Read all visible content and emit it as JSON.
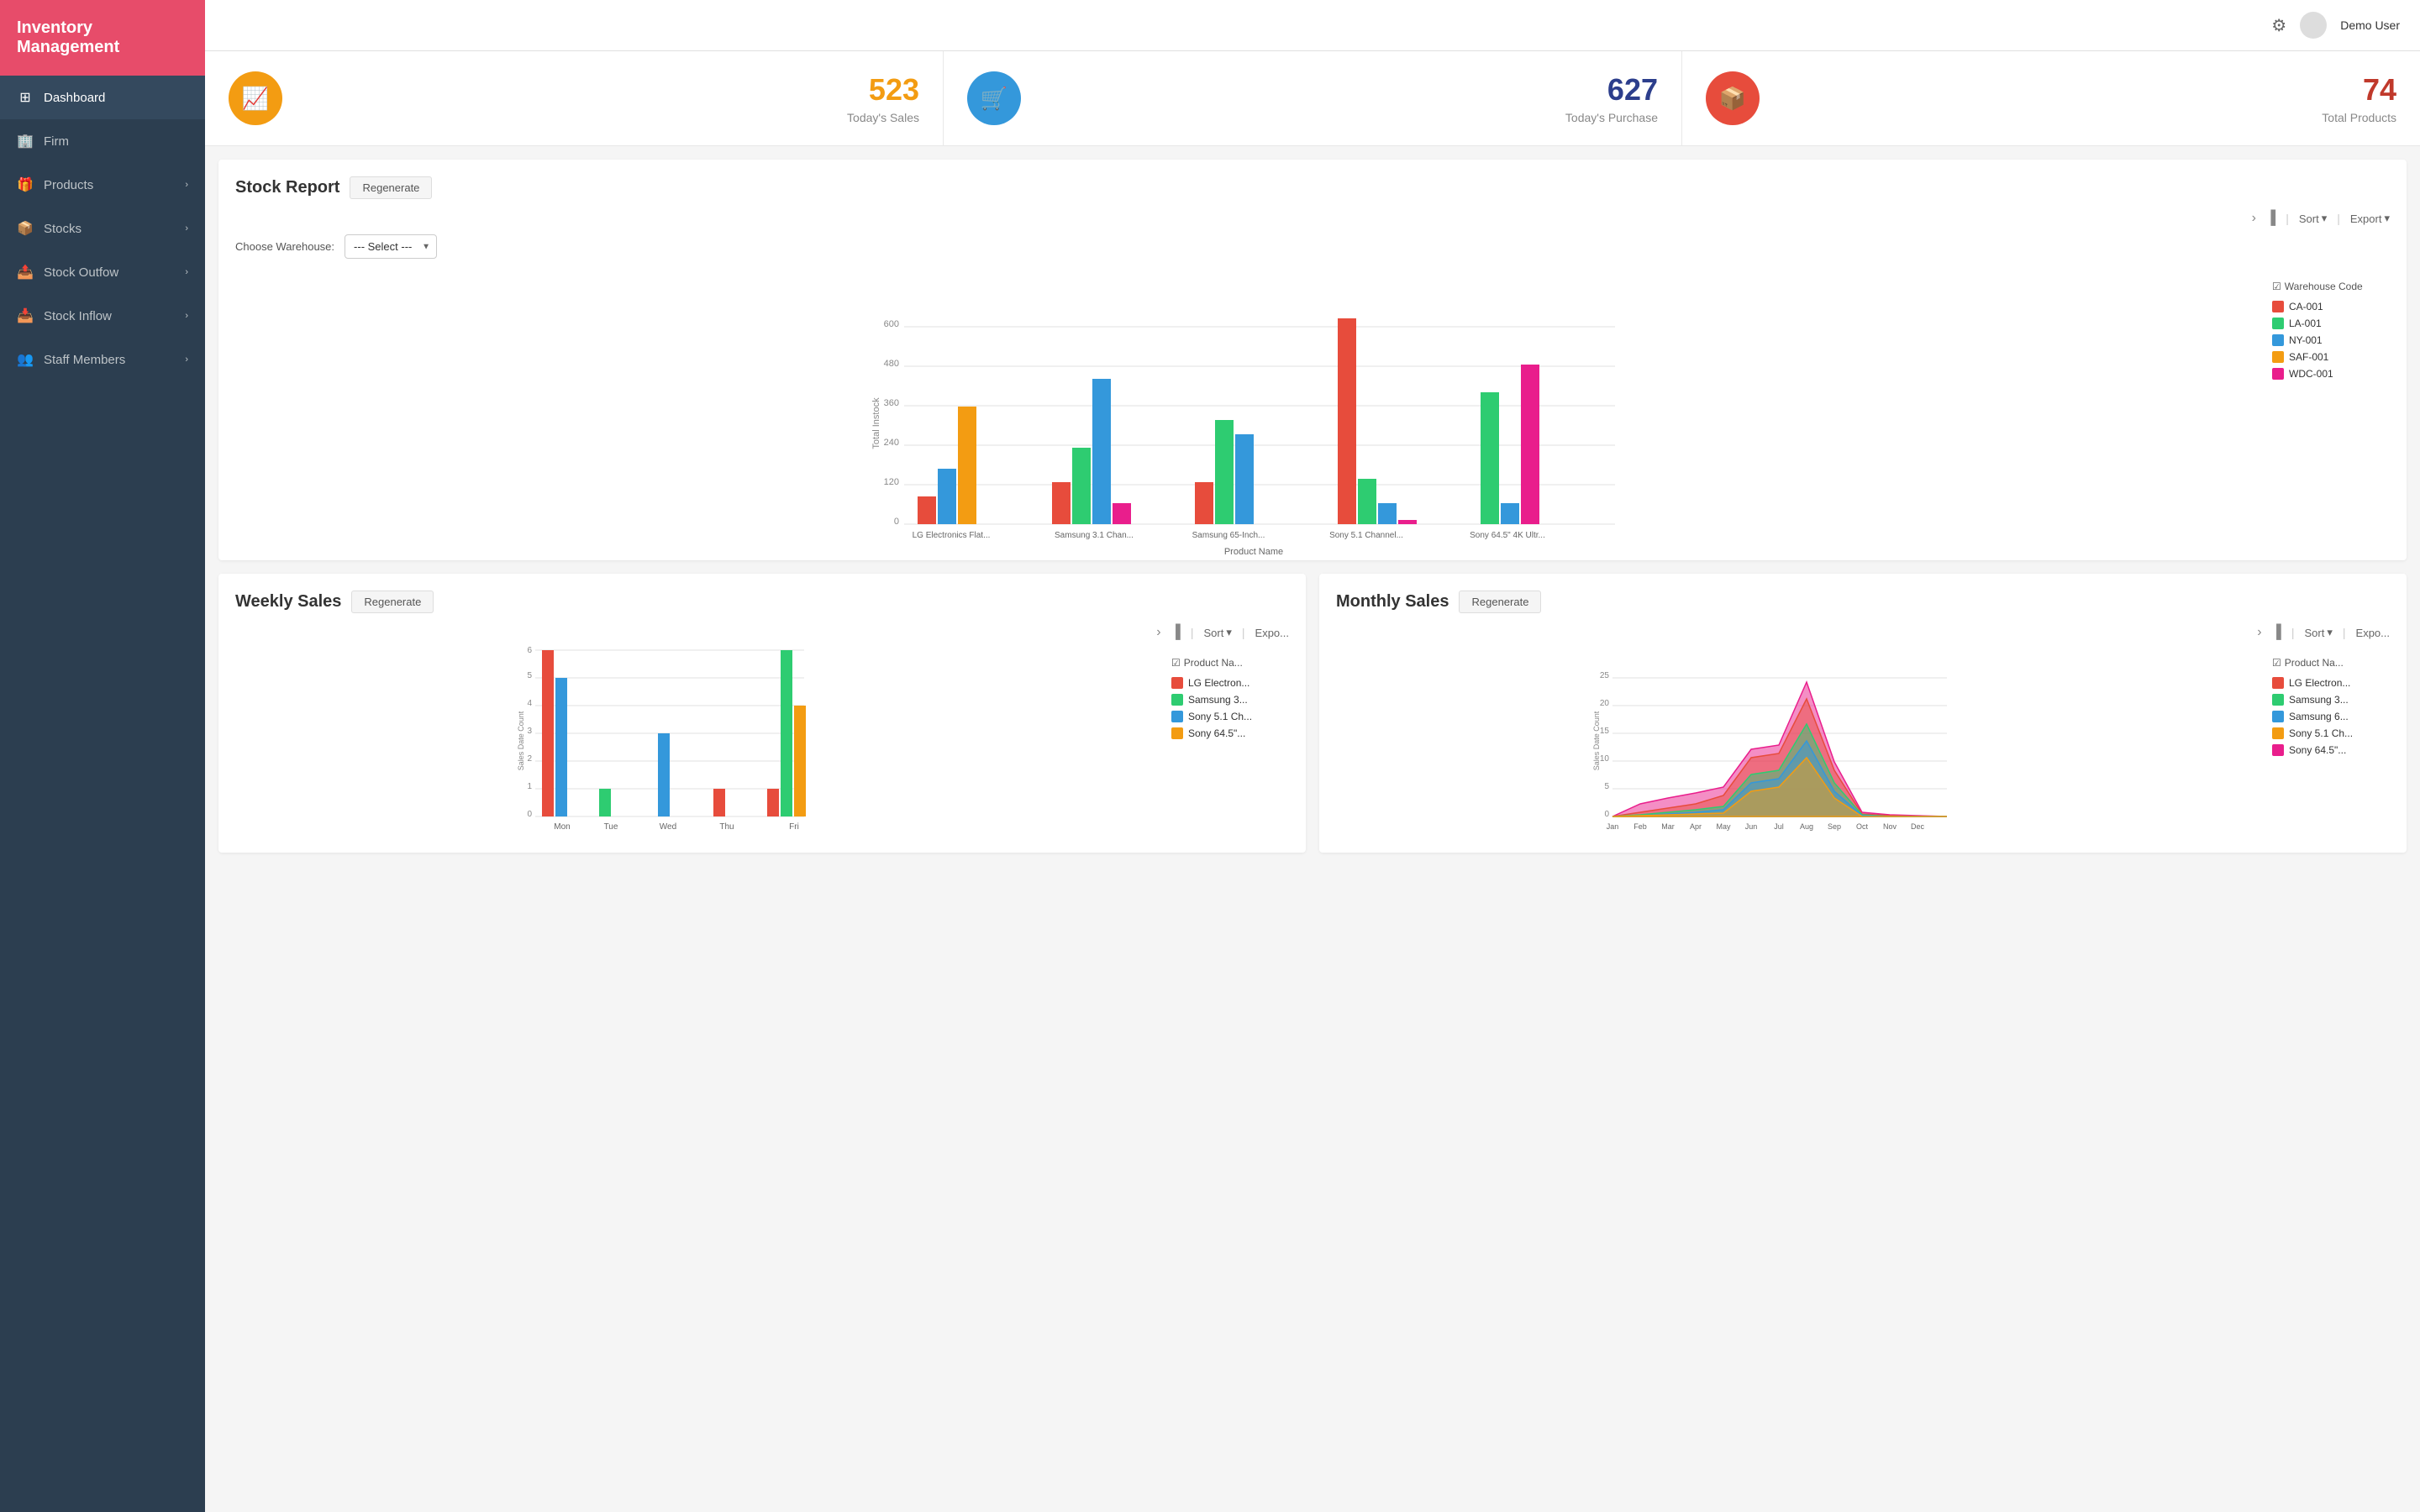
{
  "app": {
    "title": "Inventory Management"
  },
  "topbar": {
    "user": "Demo User"
  },
  "sidebar": {
    "items": [
      {
        "id": "dashboard",
        "label": "Dashboard",
        "icon": "⊞",
        "active": true,
        "hasChevron": false
      },
      {
        "id": "firm",
        "label": "Firm",
        "icon": "🏢",
        "active": false,
        "hasChevron": false
      },
      {
        "id": "products",
        "label": "Products",
        "icon": "🎁",
        "active": false,
        "hasChevron": true
      },
      {
        "id": "stocks",
        "label": "Stocks",
        "icon": "📦",
        "active": false,
        "hasChevron": true
      },
      {
        "id": "stock-outflow",
        "label": "Stock Outfow",
        "icon": "📤",
        "active": false,
        "hasChevron": true
      },
      {
        "id": "stock-inflow",
        "label": "Stock Inflow",
        "icon": "📥",
        "active": false,
        "hasChevron": true
      },
      {
        "id": "staff",
        "label": "Staff Members",
        "icon": "👥",
        "active": false,
        "hasChevron": true
      }
    ]
  },
  "stats": [
    {
      "id": "today-sales",
      "number": "523",
      "label": "Today's Sales",
      "colorClass": "gold",
      "icon": "📈"
    },
    {
      "id": "today-purchase",
      "number": "627",
      "label": "Today's Purchase",
      "colorClass": "blue",
      "icon": "🛒"
    },
    {
      "id": "total-products",
      "number": "74",
      "label": "Total Products",
      "colorClass": "red",
      "icon": "📦"
    }
  ],
  "stock_report": {
    "title": "Stock Report",
    "regenerate_label": "Regenerate",
    "warehouse_label": "Choose Warehouse:",
    "warehouse_select_default": "--- Select ---",
    "sort_label": "Sort",
    "export_label": "Export",
    "legend_title": "Warehouse Code",
    "legend_items": [
      {
        "code": "CA-001",
        "color": "#e74c3c"
      },
      {
        "code": "LA-001",
        "color": "#2ecc71"
      },
      {
        "code": "NY-001",
        "color": "#3498db"
      },
      {
        "code": "SAF-001",
        "color": "#f39c12"
      },
      {
        "code": "WDC-001",
        "color": "#e91e8c"
      }
    ],
    "products": [
      "LG Electronics Flat...",
      "Samsung 3.1 Chan...",
      "Samsung 65-Inch...",
      "Sony 5.1 Channel...",
      "Sony 64.5\" 4K Ultr..."
    ],
    "bars": [
      [
        80,
        160,
        340,
        0,
        0
      ],
      [
        120,
        220,
        420,
        0,
        60
      ],
      [
        120,
        300,
        260,
        0,
        0
      ],
      [
        0,
        0,
        0,
        600,
        130
      ],
      [
        0,
        380,
        0,
        60,
        460
      ]
    ],
    "y_axis": [
      0,
      120,
      240,
      360,
      480,
      600
    ],
    "y_label": "Total Instock",
    "x_label": "Product Name"
  },
  "weekly_sales": {
    "title": "Weekly Sales",
    "regenerate_label": "Regenerate",
    "sort_label": "Sort",
    "export_label": "Expo...",
    "legend_title": "Product Na...",
    "legend_items": [
      {
        "label": "LG Electron...",
        "color": "#e74c3c"
      },
      {
        "label": "Samsung 3...",
        "color": "#2ecc71"
      },
      {
        "label": "Sony 5.1 Ch...",
        "color": "#3498db"
      },
      {
        "label": "Sony 64.5\"...",
        "color": "#f39c12"
      }
    ],
    "days": [
      "Mon",
      "Tue",
      "Wed",
      "Thu",
      "Fri"
    ],
    "bars": [
      [
        6,
        0,
        0,
        1,
        1
      ],
      [
        5,
        1,
        3,
        0,
        0
      ],
      [
        0,
        0,
        0,
        0,
        6
      ],
      [
        0,
        0,
        0,
        0,
        4
      ]
    ],
    "y_axis": [
      0,
      1,
      2,
      3,
      4,
      5,
      6
    ],
    "y_label": "Sales Date Count"
  },
  "monthly_sales": {
    "title": "Monthly Sales",
    "regenerate_label": "Regenerate",
    "sort_label": "Sort",
    "export_label": "Expo...",
    "legend_title": "Product Na...",
    "legend_items": [
      {
        "label": "LG Electron...",
        "color": "#e74c3c"
      },
      {
        "label": "Samsung 3...",
        "color": "#2ecc71"
      },
      {
        "label": "Samsung 6...",
        "color": "#3498db"
      },
      {
        "label": "Sony 5.1 Ch...",
        "color": "#f39c12"
      },
      {
        "label": "Sony 64.5\"...",
        "color": "#e91e8c"
      }
    ],
    "months": [
      "Jan",
      "Feb",
      "Mar",
      "Apr",
      "May",
      "Jun",
      "Jul",
      "Aug",
      "Sep",
      "Oct",
      "Nov",
      "Dec"
    ],
    "y_axis": [
      0,
      5,
      10,
      15,
      20,
      25
    ],
    "y_label": "Sales Date Count"
  }
}
